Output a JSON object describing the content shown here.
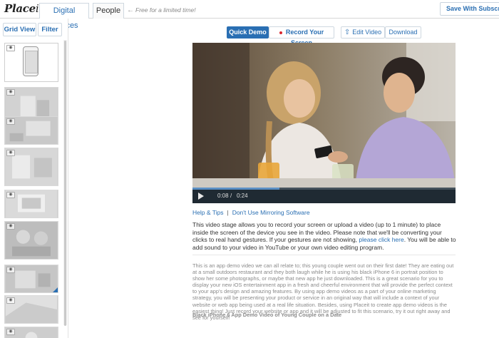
{
  "header": {
    "logo_main": "Place",
    "logo_suffix": "it",
    "tabs": [
      {
        "label": "Digital Devices",
        "active": true
      },
      {
        "label": "People",
        "active": false
      }
    ],
    "promo_note": "Free for a limited time!",
    "save_button": "Save With Subscription"
  },
  "sidebar": {
    "grid_view_label": "Grid View",
    "filter_label": "Filter",
    "thumbnails": [
      {
        "kind": "phone-mockup",
        "selected": true
      },
      {
        "kind": "photo",
        "has_corner": true
      },
      {
        "kind": "photo",
        "has_corner": false
      },
      {
        "kind": "photo",
        "has_corner": false
      },
      {
        "kind": "photo",
        "has_corner": false
      },
      {
        "kind": "photo",
        "has_corner": false
      },
      {
        "kind": "photo",
        "has_corner": true
      },
      {
        "kind": "photo",
        "has_corner": false
      },
      {
        "kind": "photo",
        "has_corner": false
      }
    ]
  },
  "toolbar": {
    "quick_demo": "Quick Demo",
    "record_screen": "Record Your Screen",
    "edit_video": "Edit Video",
    "download": "Download"
  },
  "player": {
    "current_time": "0:08",
    "separator": "/",
    "duration": "0:24",
    "progress_fraction": 0.33
  },
  "links": {
    "help_tips": "Help & Tips",
    "separator": "|",
    "no_mirroring": "Don't Use Mirroring Software"
  },
  "description": {
    "intro": "This video stage allows you to record your screen or upload a video (up to 1 minute) to place inside the screen of the device you see in the video. Please note that we'll be converting your clicks to real hand gestures. If your gestures are not showing, ",
    "link": "please click here",
    "outro": ". You will be able to add sound to your video in YouTube or your own video editing program."
  },
  "long_description": "This is an app demo video we can all relate to; this young couple went out on their first date! They are eating out at a small outdoors restaurant and they both laugh while he is using his black iPhone 6 in portrait position to show her some photographs, or maybe that new app he just downloaded. This is a great scenario for you to display your new iOS entertainment app in a fresh and cheerful environment that will provide the perfect context to your app's design and amazing features. By using app demo videos as a part of your online marketing strategy, you will be presenting your product or service in an original way that will include a context of your website or web app being used at a real life situation. Besides, using Placeit to create app demo videos is the easiest thing! Just record your website or app and it will be adjusted to fit this scenario, try it out right away and see for yourself!",
  "video_title": "Black iPhone 6 App Demo Video of Young Couple on a Date",
  "colors": {
    "accent": "#2a6fb3",
    "record_dot": "#d9262e"
  }
}
